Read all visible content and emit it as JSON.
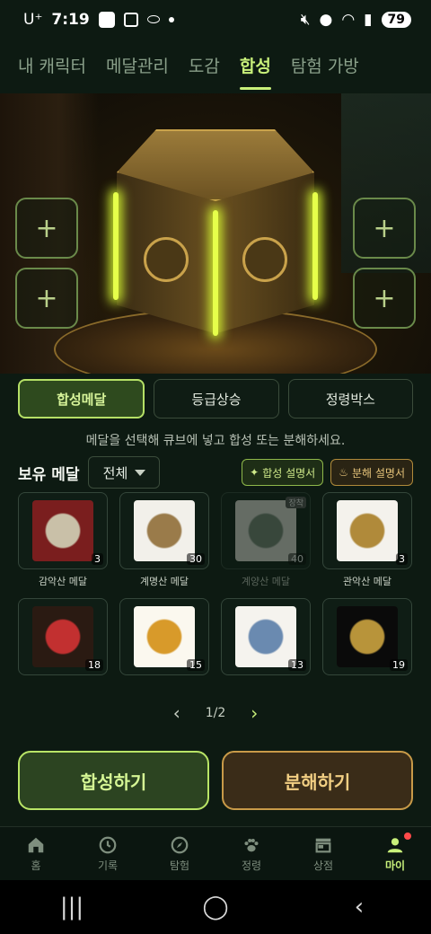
{
  "status_bar": {
    "carrier": "U⁺",
    "time": "7:19",
    "battery": "79"
  },
  "top_tabs": [
    {
      "label": "내 캐릭터",
      "active": false
    },
    {
      "label": "메달관리",
      "active": false
    },
    {
      "label": "도감",
      "active": false
    },
    {
      "label": "합성",
      "active": true
    },
    {
      "label": "탐험 가방",
      "active": false
    }
  ],
  "slots": {
    "plus": "+"
  },
  "action_tabs": [
    {
      "label": "합성메달",
      "active": true
    },
    {
      "label": "등급상승",
      "active": false
    },
    {
      "label": "정령박스",
      "active": false
    }
  ],
  "guide_text": "메달을 선택해 큐브에 넣고 합성 또는 분해하세요.",
  "owned": {
    "title": "보유 메달",
    "filter_value": "전체",
    "help_synth": "합성 설명서",
    "help_decomp": "분해 설명서"
  },
  "medals": [
    {
      "name": "감악산 메달",
      "count": "3",
      "dim": false,
      "tag": "",
      "colors": [
        "#7a1e1e",
        "#c9c0a8"
      ]
    },
    {
      "name": "계명산 메달",
      "count": "30",
      "dim": false,
      "tag": "",
      "colors": [
        "#f2f0ea",
        "#9a7b4a"
      ]
    },
    {
      "name": "계양산 메달",
      "count": "40",
      "dim": true,
      "tag": "장착",
      "colors": [
        "#e9e7e0",
        "#7a8a7a"
      ]
    },
    {
      "name": "관악산 메달",
      "count": "3",
      "dim": false,
      "tag": "",
      "colors": [
        "#f4f2ec",
        "#b08a3a"
      ]
    },
    {
      "name": "",
      "count": "18",
      "dim": false,
      "tag": "",
      "colors": [
        "#2a1a12",
        "#c23030"
      ]
    },
    {
      "name": "",
      "count": "15",
      "dim": false,
      "tag": "",
      "colors": [
        "#fbf8ef",
        "#d89a2a"
      ]
    },
    {
      "name": "",
      "count": "13",
      "dim": false,
      "tag": "",
      "colors": [
        "#f5f3ee",
        "#6a8ab0"
      ]
    },
    {
      "name": "",
      "count": "19",
      "dim": false,
      "tag": "",
      "colors": [
        "#0a0a0a",
        "#b8943a"
      ]
    }
  ],
  "pager": {
    "current": "1/2",
    "prev": "‹",
    "next": "›"
  },
  "buttons": {
    "synthesize": "합성하기",
    "decompose": "분해하기"
  },
  "bottom_nav": [
    {
      "label": "홈",
      "icon": "home-icon",
      "active": false
    },
    {
      "label": "기록",
      "icon": "history-icon",
      "active": false
    },
    {
      "label": "탐험",
      "icon": "compass-icon",
      "active": false
    },
    {
      "label": "정령",
      "icon": "paw-icon",
      "active": false
    },
    {
      "label": "상점",
      "icon": "store-icon",
      "active": false
    },
    {
      "label": "마이",
      "icon": "person-icon",
      "active": true
    }
  ],
  "colors": {
    "accent_green": "#c8f07a",
    "accent_gold": "#c89a48",
    "background": "#0d1a12"
  }
}
